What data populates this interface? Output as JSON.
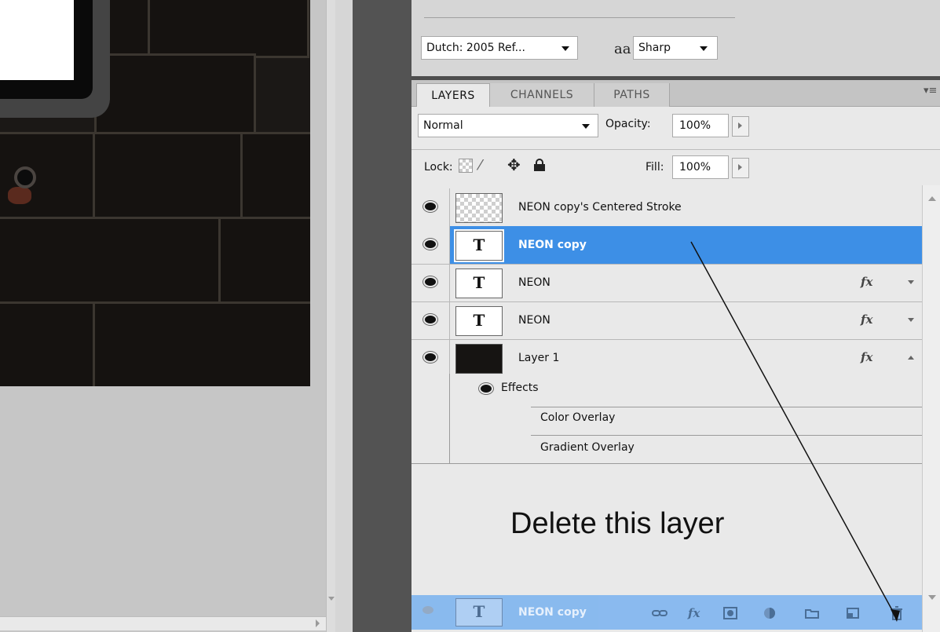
{
  "character": {
    "font": "Dutch: 2005 Ref...",
    "aa_icon": "aa",
    "antialias": "Sharp"
  },
  "layers_panel": {
    "tabs": [
      {
        "label": "LAYERS",
        "active": true
      },
      {
        "label": "CHANNELS",
        "active": false
      },
      {
        "label": "PATHS",
        "active": false
      }
    ],
    "menu_icon": "panel-menu-icon",
    "blend_mode": "Normal",
    "opacity_label": "Opacity:",
    "opacity_value": "100%",
    "lock_label": "Lock:",
    "fill_label": "Fill:",
    "fill_value": "100%",
    "layers": [
      {
        "name": "NEON copy's Centered Stroke",
        "thumb": "checker",
        "selected": false,
        "fx": ""
      },
      {
        "name": "NEON copy",
        "thumb": "T",
        "selected": true,
        "fx": ""
      },
      {
        "name": "NEON",
        "thumb": "T",
        "selected": false,
        "fx": "fx"
      },
      {
        "name": "NEON",
        "thumb": "T",
        "selected": false,
        "fx": "fx"
      },
      {
        "name": "Layer 1",
        "thumb": "dark",
        "selected": false,
        "fx": "fx"
      }
    ],
    "effects_label": "Effects",
    "effects": [
      "Color Overlay",
      "Gradient Overlay"
    ],
    "dragging_layer": {
      "thumb": "T",
      "name": "NEON copy"
    },
    "bottom_icons": [
      "link-icon",
      "fx-icon",
      "mask-icon",
      "adjustment-icon",
      "folder-icon",
      "new-layer-icon",
      "trash-icon"
    ]
  },
  "annotation": "Delete this layer",
  "colors": {
    "selection": "#3d8fe6",
    "panel_bg": "#d6d6d6",
    "list_bg": "#e9e9e9"
  }
}
